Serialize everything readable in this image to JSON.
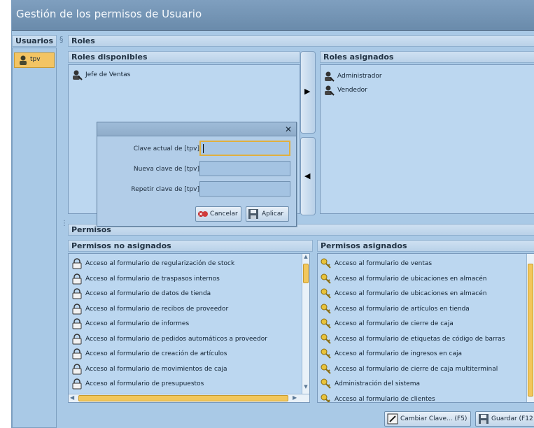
{
  "window": {
    "title": "Gestión de los permisos de Usuario"
  },
  "usuarios": {
    "header": "Usuarios",
    "items": [
      "tpv"
    ]
  },
  "roles": {
    "header": "Roles",
    "disponibles": {
      "header": "Roles disponibles",
      "items": [
        "Jefe de Ventas"
      ]
    },
    "asignados": {
      "header": "Roles asignados",
      "items": [
        "Administrador",
        "Vendedor"
      ]
    }
  },
  "dialog": {
    "fields": [
      {
        "label": "Clave actual de [tpv]",
        "value": ""
      },
      {
        "label": "Nueva clave de [tpv]",
        "value": ""
      },
      {
        "label": "Repetir clave de [tpv]",
        "value": ""
      }
    ],
    "cancel_label": "Cancelar",
    "apply_label": "Aplicar"
  },
  "permisos": {
    "header": "Permisos",
    "no_asignados": {
      "header": "Permisos no asignados",
      "items": [
        "Acceso al formulario de regularización de stock",
        "Acceso al formulario de traspasos internos",
        "Acceso al formulario de datos de tienda",
        "Acceso al formulario de recibos de proveedor",
        "Acceso al formulario de informes",
        "Acceso al formulario de pedidos automáticos a proveedor",
        "Acceso al formulario de creación de artículos",
        "Acceso al formulario de movimientos de caja",
        "Acceso al formulario de presupuestos"
      ]
    },
    "asignados": {
      "header": "Permisos asignados",
      "items": [
        "Acceso al formulario de ventas",
        "Acceso al formulario de ubicaciones en almacén",
        "Acceso al formulario de ubicaciones en almacén",
        "Acceso al formulario de artículos en tienda",
        "Acceso al formulario de cierre de caja",
        "Acceso al formulario de etiquetas de código de barras",
        "Acceso al formulario de ingresos en caja",
        "Acceso al formulario de cierre de caja multiterminal",
        "Administración del sistema",
        "Acceso al formulario de clientes"
      ]
    }
  },
  "footer": {
    "change_password_label": "Cambiar Clave... (F5)",
    "save_label": "Guardar (F12"
  },
  "colors": {
    "window_bg": "#a9c9e6",
    "titlebar": "#6a8bab",
    "scroll_thumb": "#f2c75c",
    "focus_border": "#e0b040"
  }
}
